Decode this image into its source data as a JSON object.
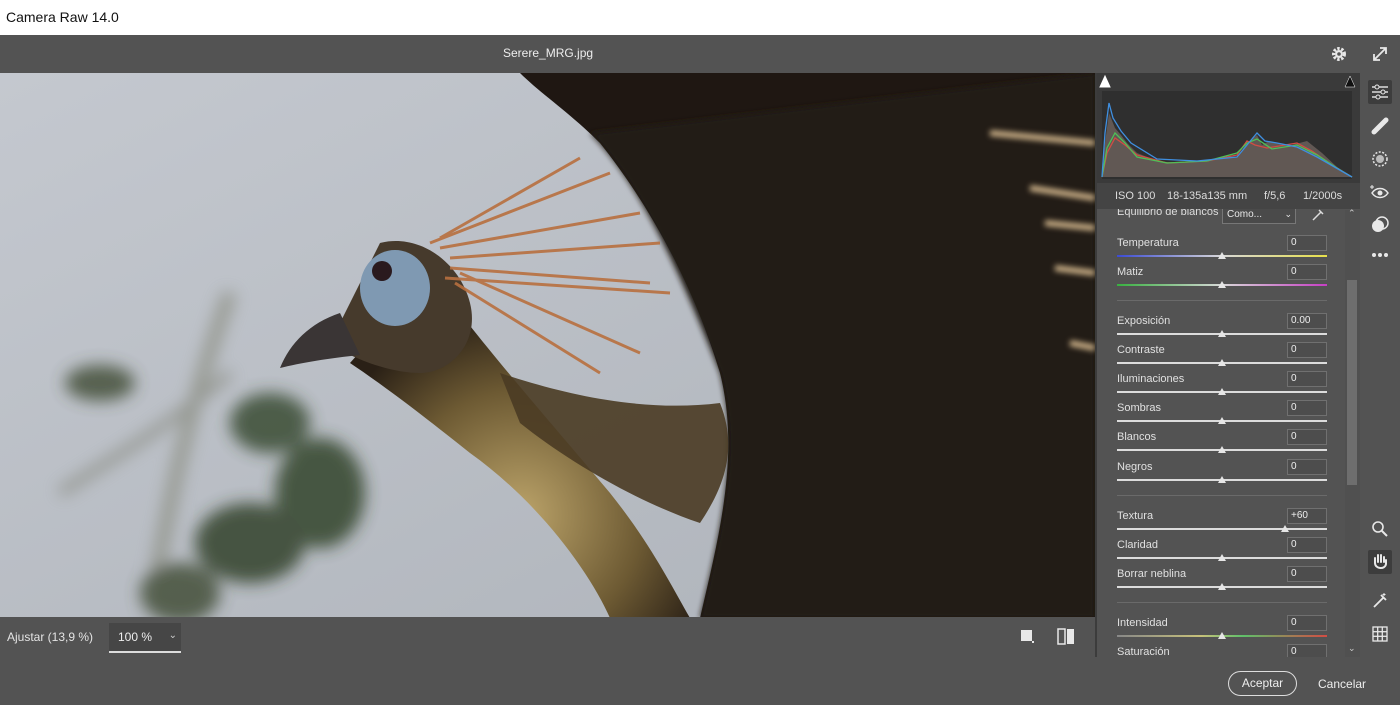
{
  "app": {
    "title": "Camera Raw 14.0"
  },
  "file": {
    "name": "Serere_MRG.jpg"
  },
  "camera": {
    "iso": "ISO 100",
    "lens": "18-135a135 mm",
    "aperture": "f/5,6",
    "shutter": "1/2000s"
  },
  "white_balance": {
    "label": "Equilibrio de blancos",
    "value": "Como..."
  },
  "sliders": [
    {
      "label": "Temperatura",
      "value": "0",
      "level": 0.5
    },
    {
      "label": "Matiz",
      "value": "0",
      "level": 0.5
    },
    {
      "label": "Exposición",
      "value": "0.00",
      "level": 0.5
    },
    {
      "label": "Contraste",
      "value": "0",
      "level": 0.5
    },
    {
      "label": "Iluminaciones",
      "value": "0",
      "level": 0.5
    },
    {
      "label": "Sombras",
      "value": "0",
      "level": 0.5
    },
    {
      "label": "Blancos",
      "value": "0",
      "level": 0.5
    },
    {
      "label": "Negros",
      "value": "0",
      "level": 0.5
    },
    {
      "label": "Textura",
      "value": "+60",
      "level": 0.8
    },
    {
      "label": "Claridad",
      "value": "0",
      "level": 0.5
    },
    {
      "label": "Borrar neblina",
      "value": "0",
      "level": 0.5
    },
    {
      "label": "Intensidad",
      "value": "0",
      "level": 0.5
    },
    {
      "label": "Saturación",
      "value": "0",
      "level": 0.5
    }
  ],
  "view": {
    "fit_label": "Ajustar (13,9 %)",
    "zoom_value": "100 %"
  },
  "footer": {
    "accept": "Aceptar",
    "cancel": "Cancelar"
  },
  "colors": {
    "background": "#535353",
    "panel_dark": "#3a3a3a",
    "accent": "#e8e8e8"
  }
}
